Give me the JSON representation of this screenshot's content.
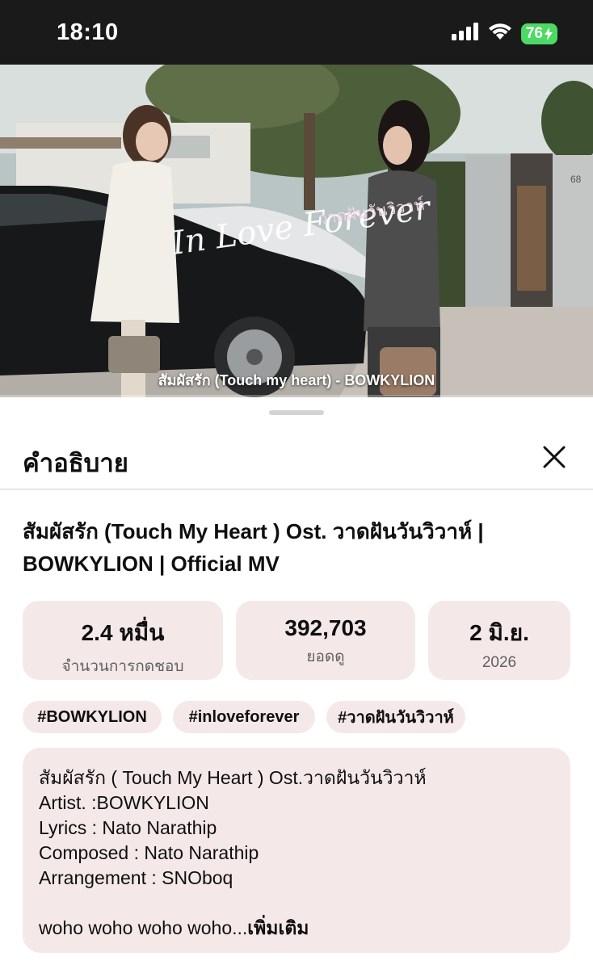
{
  "status_bar": {
    "time": "18:10",
    "battery": "76"
  },
  "video": {
    "caption": "สัมผัสรัก (Touch my heart) - BOWKYLION",
    "logo_text": "In Love Forever",
    "logo_thai": "วาดฝันวันวิวาห์",
    "house_number": "68",
    "progress_fraction": 0.0
  },
  "sheet": {
    "title": "คำอธิบาย",
    "video_title_line1": "สัมผัสรัก (Touch My Heart ) Ost. วาดฝันวันวิวาห์ |",
    "video_title_line2": "BOWKYLION | Official MV",
    "stats": {
      "likes_value": "2.4 หมื่น",
      "likes_label": "จำนวนการกดชอบ",
      "views_value": "392,703",
      "views_label": "ยอดดู",
      "date_value": "2 มิ.ย.",
      "date_year": "2026"
    },
    "hashtags": [
      "#BOWKYLION",
      "#inloveforever",
      "#วาดฝันวันวิวาห์"
    ],
    "description": {
      "lines": [
        "สัมผัสรัก ( Touch My Heart ) Ost.วาดฝันวันวิวาห์",
        "Artist. :BOWKYLION",
        "Lyrics : Nato Narathip",
        "Composed : Nato Narathip",
        "Arrangement : SNOboq"
      ],
      "snippet": "woho woho woho woho...",
      "more_label": "เพิ่มเติม"
    }
  },
  "colors": {
    "chip_bg": "#f4e9e8",
    "status_bar_bg": "#1a1a1a",
    "battery_green": "#4cd964"
  },
  "icons": {
    "signal": "cellular-signal-icon",
    "wifi": "wifi-icon",
    "battery": "battery-charging-icon",
    "close": "close-icon"
  }
}
